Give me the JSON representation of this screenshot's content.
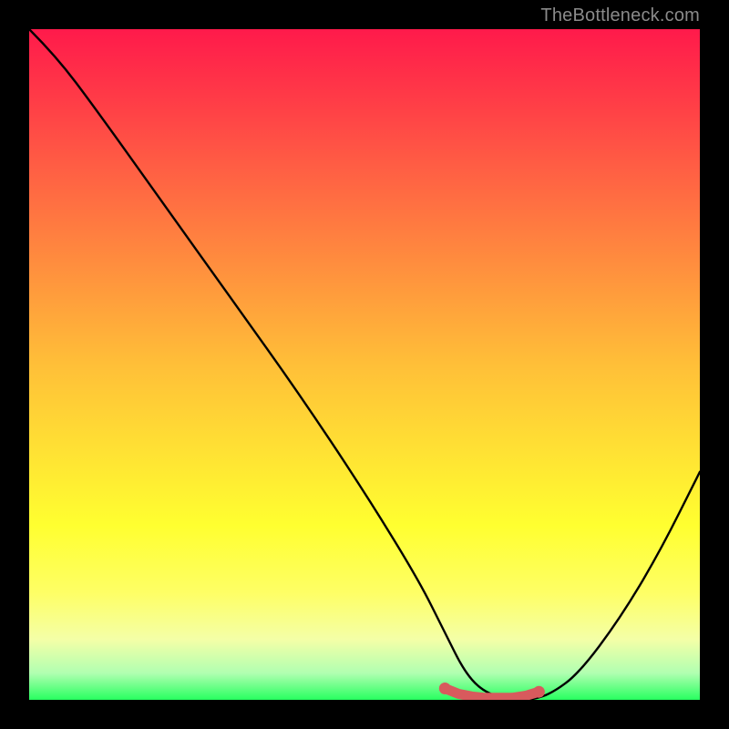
{
  "watermark": {
    "text": "TheBottleneck.com"
  },
  "colors": {
    "background": "#000000",
    "curve": "#000000",
    "marker": "#d85a5d",
    "gradient_top": "#ff1a4b",
    "gradient_bottom": "#28ff60"
  },
  "chart_data": {
    "type": "line",
    "title": "",
    "xlabel": "",
    "ylabel": "",
    "xlim": [
      0,
      100
    ],
    "ylim": [
      0,
      100
    ],
    "series": [
      {
        "name": "bottleneck-curve",
        "x": [
          0,
          4,
          10,
          20,
          30,
          40,
          50,
          58,
          62,
          65,
          68,
          72,
          75,
          78,
          82,
          88,
          94,
          100
        ],
        "y": [
          100,
          96,
          88,
          74,
          60,
          46,
          31,
          18,
          10,
          4,
          1,
          0,
          0,
          1,
          4,
          12,
          22,
          34
        ]
      }
    ],
    "markers": {
      "name": "optimal-range",
      "x": [
        62,
        64,
        66,
        68,
        70,
        72,
        74,
        76
      ],
      "y": [
        1.7,
        0.9,
        0.5,
        0.3,
        0.3,
        0.3,
        0.6,
        1.2
      ]
    }
  }
}
